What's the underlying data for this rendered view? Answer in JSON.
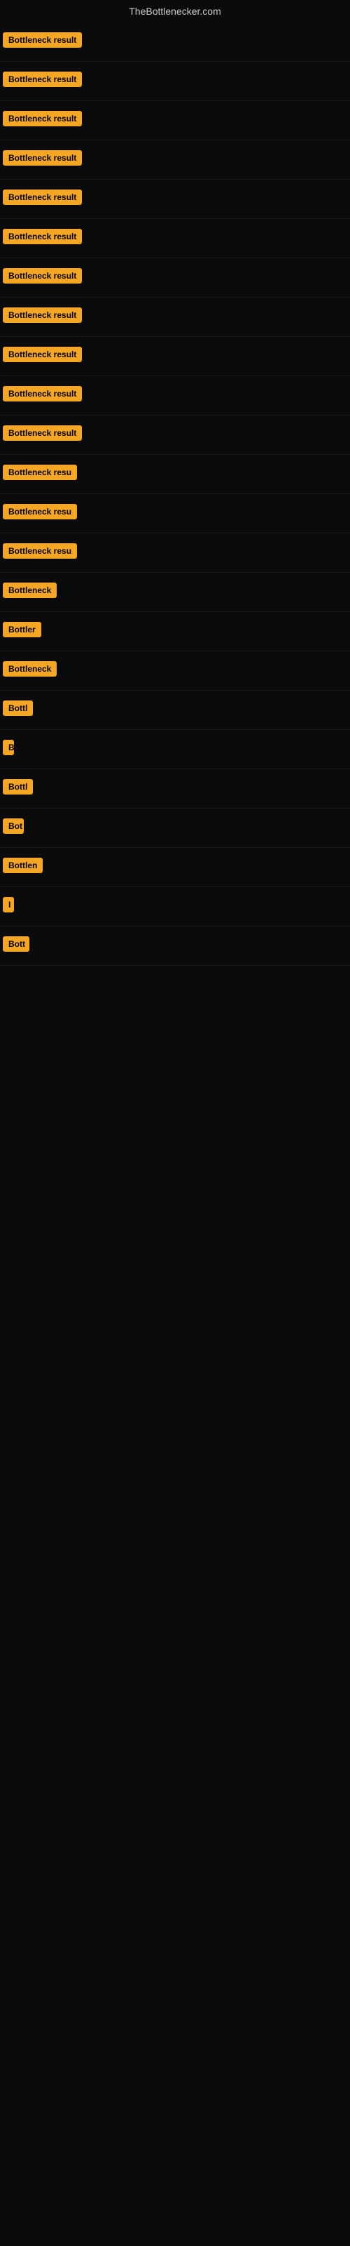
{
  "site": {
    "title": "TheBottlenecker.com"
  },
  "rows": [
    {
      "id": 1,
      "label": "Bottleneck result",
      "width": 160
    },
    {
      "id": 2,
      "label": "Bottleneck result",
      "width": 160
    },
    {
      "id": 3,
      "label": "Bottleneck result",
      "width": 160
    },
    {
      "id": 4,
      "label": "Bottleneck result",
      "width": 160
    },
    {
      "id": 5,
      "label": "Bottleneck result",
      "width": 160
    },
    {
      "id": 6,
      "label": "Bottleneck result",
      "width": 160
    },
    {
      "id": 7,
      "label": "Bottleneck result",
      "width": 160
    },
    {
      "id": 8,
      "label": "Bottleneck result",
      "width": 160
    },
    {
      "id": 9,
      "label": "Bottleneck result",
      "width": 160
    },
    {
      "id": 10,
      "label": "Bottleneck result",
      "width": 160
    },
    {
      "id": 11,
      "label": "Bottleneck result",
      "width": 155
    },
    {
      "id": 12,
      "label": "Bottleneck resu",
      "width": 130
    },
    {
      "id": 13,
      "label": "Bottleneck resu",
      "width": 130
    },
    {
      "id": 14,
      "label": "Bottleneck resu",
      "width": 130
    },
    {
      "id": 15,
      "label": "Bottleneck",
      "width": 85
    },
    {
      "id": 16,
      "label": "Bottler",
      "width": 55
    },
    {
      "id": 17,
      "label": "Bottleneck",
      "width": 85
    },
    {
      "id": 18,
      "label": "Bottl",
      "width": 45
    },
    {
      "id": 19,
      "label": "B",
      "width": 14
    },
    {
      "id": 20,
      "label": "Bottl",
      "width": 45
    },
    {
      "id": 21,
      "label": "Bot",
      "width": 30
    },
    {
      "id": 22,
      "label": "Bottlen",
      "width": 60
    },
    {
      "id": 23,
      "label": "I",
      "width": 8
    },
    {
      "id": 24,
      "label": "Bott",
      "width": 38
    }
  ]
}
